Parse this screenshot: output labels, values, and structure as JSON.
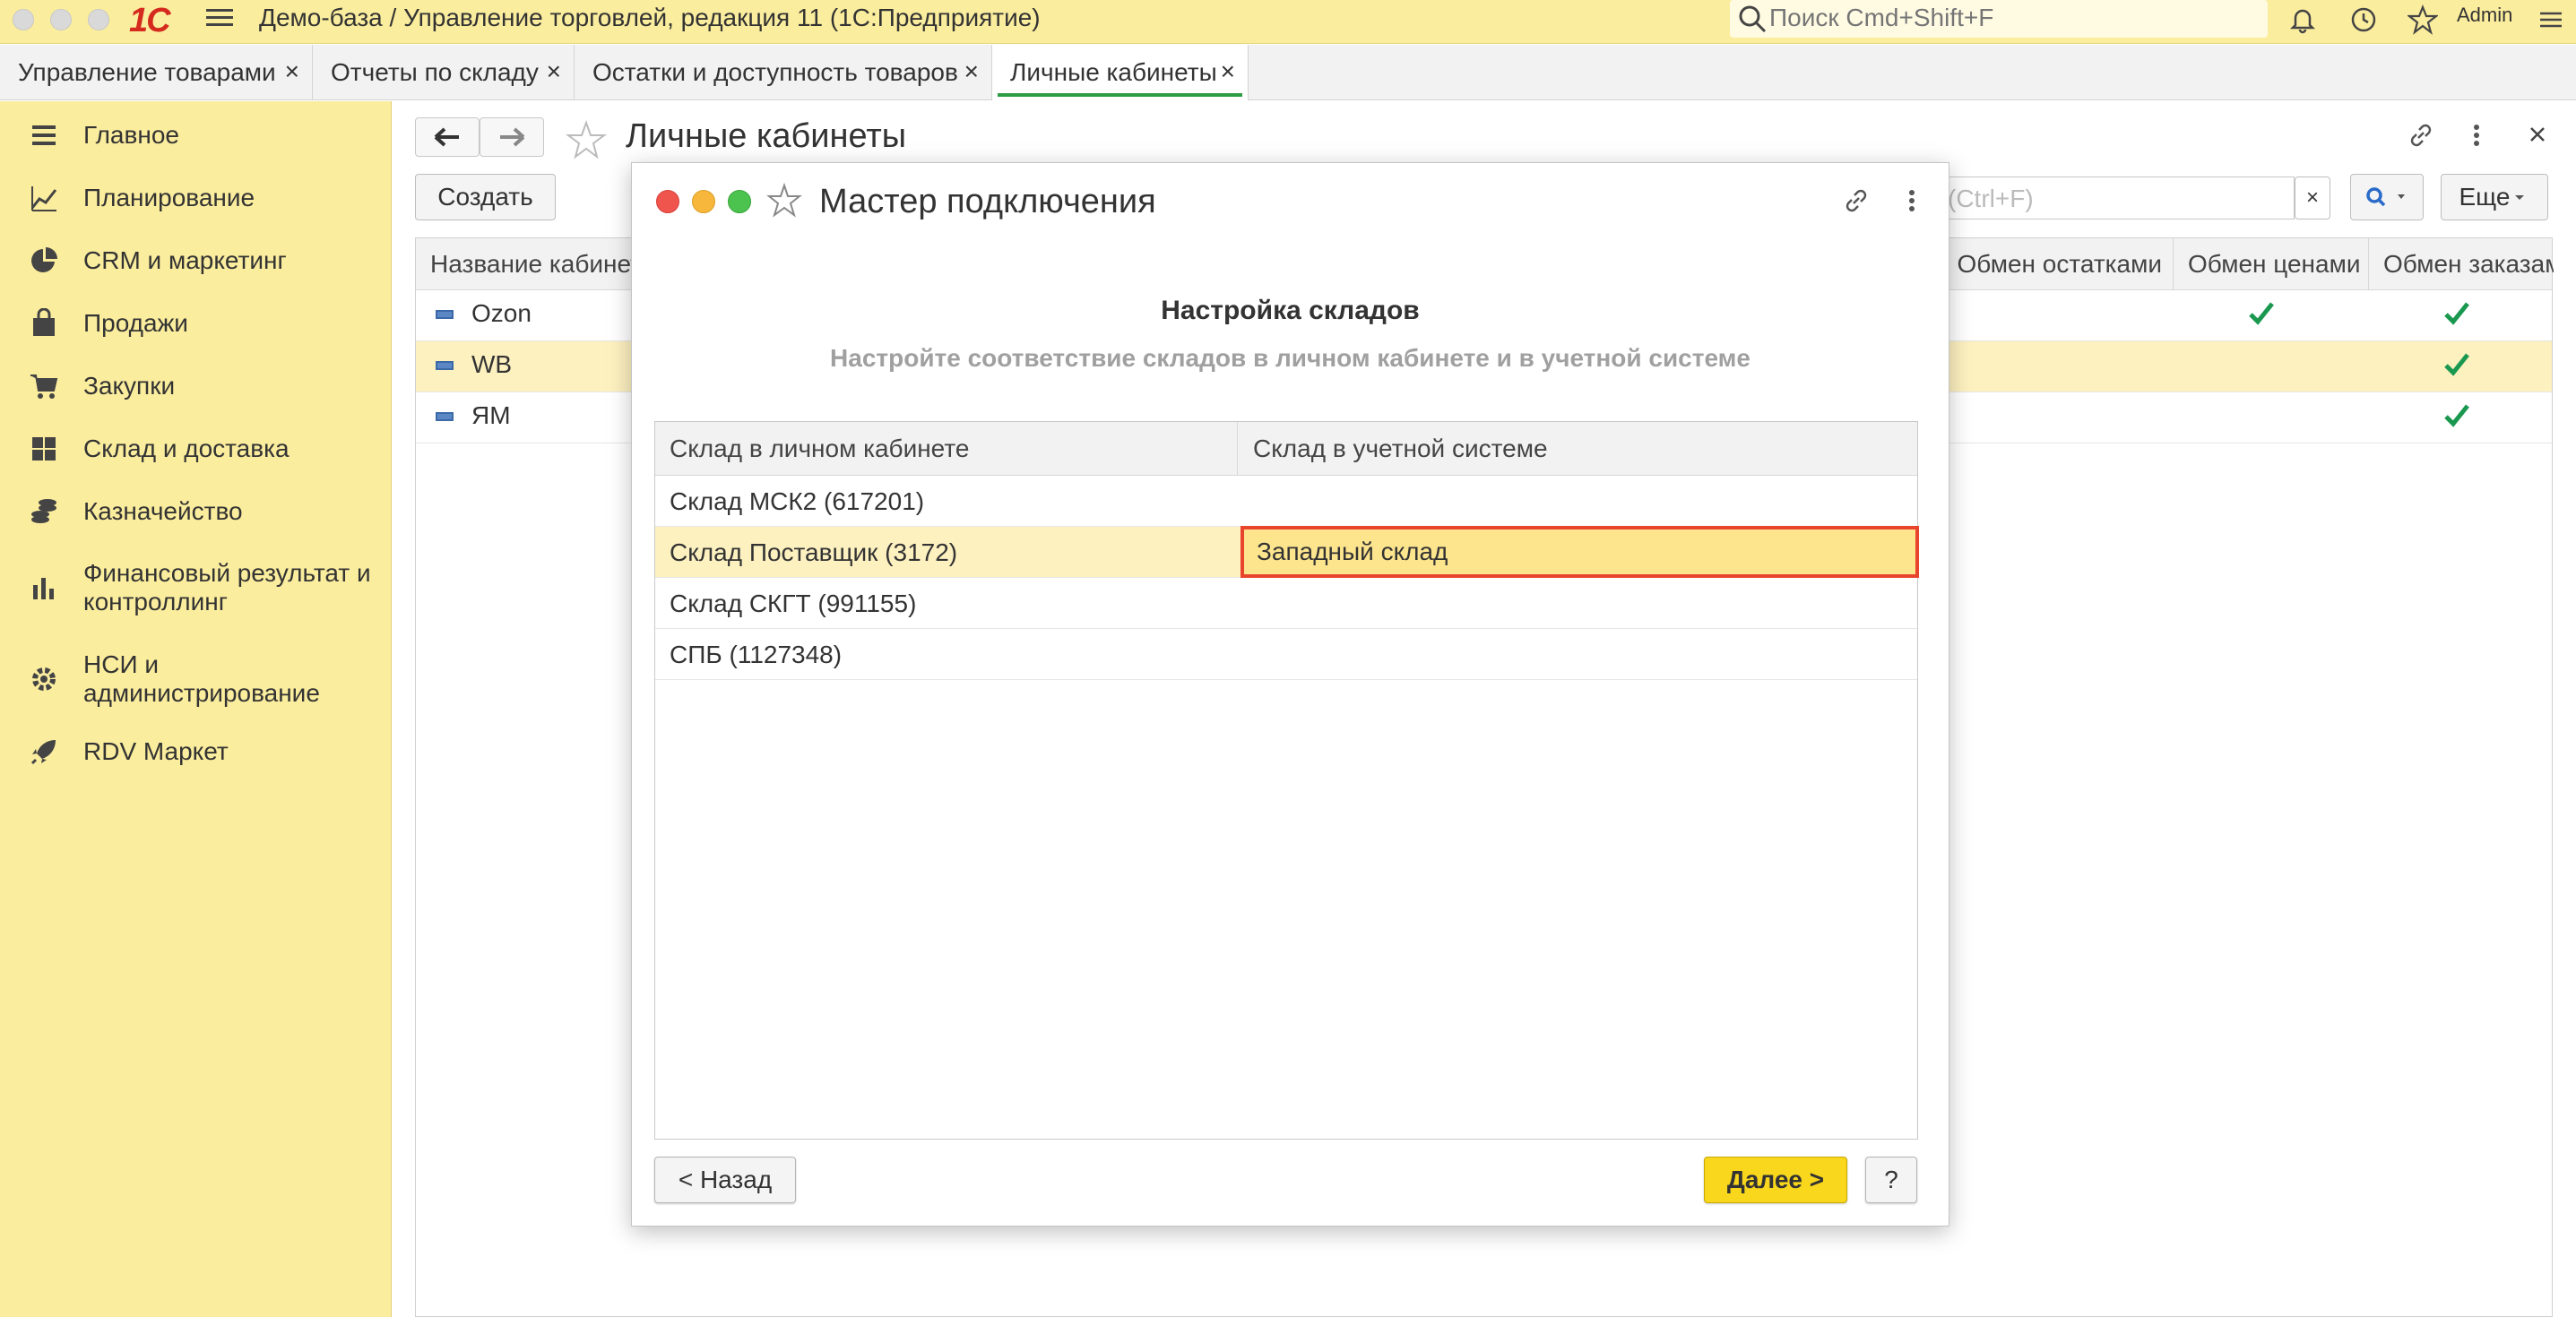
{
  "app": {
    "logo": "1С",
    "title": "Демо-база / Управление торговлей, редакция 11  (1С:Предприятие)",
    "search_placeholder": "Поиск Cmd+Shift+F",
    "user": "Admin"
  },
  "tabs": [
    {
      "label": "Управление товарами",
      "close": "×"
    },
    {
      "label": "Отчеты по складу",
      "close": "×"
    },
    {
      "label": "Остатки и доступность товаров",
      "close": "×"
    },
    {
      "label": "Личные кабинеты",
      "close": "×",
      "active": true
    }
  ],
  "sidebar": {
    "items": [
      {
        "label": "Главное",
        "icon": "menu-lines-icon"
      },
      {
        "label": "Планирование",
        "icon": "planning-chart-icon"
      },
      {
        "label": "CRM и маркетинг",
        "icon": "pie-chart-icon"
      },
      {
        "label": "Продажи",
        "icon": "shopping-bag-icon"
      },
      {
        "label": "Закупки",
        "icon": "cart-icon"
      },
      {
        "label": "Склад и доставка",
        "icon": "warehouse-grid-icon"
      },
      {
        "label": "Казначейство",
        "icon": "coins-icon"
      },
      {
        "label": "Финансовый результат и контроллинг",
        "icon": "bar-chart-icon"
      },
      {
        "label": "НСИ и администрирование",
        "icon": "gear-icon"
      },
      {
        "label": "RDV Маркет",
        "icon": "rocket-icon"
      }
    ]
  },
  "form": {
    "title": "Личные кабинеты",
    "create_button": "Создать",
    "search_hint": "(Ctrl+F)",
    "clear": "×",
    "more_button": "Еще",
    "columns": [
      "Название кабинета",
      "Обмен остатками",
      "Обмен ценами",
      "Обмен заказами"
    ],
    "rows": [
      {
        "name": "Ozon",
        "prices": true,
        "orders": true
      },
      {
        "name": "WB",
        "prices": false,
        "orders": true,
        "selected": true
      },
      {
        "name": "ЯМ",
        "prices": false,
        "orders": true
      }
    ]
  },
  "dialog": {
    "title": "Мастер подключения",
    "heading": "Настройка складов",
    "subheading": "Настройте соответствие складов в личном кабинете и в учетной системе",
    "columns": [
      "Склад в личном кабинете",
      "Склад в учетной системе"
    ],
    "rows": [
      {
        "cabinet": "Склад МСК2 (617201)",
        "system": ""
      },
      {
        "cabinet": "Склад Поставщик (3172)",
        "system": "Западный склад",
        "selected": true
      },
      {
        "cabinet": "Склад СКГТ (991155)",
        "system": ""
      },
      {
        "cabinet": "СПБ (1127348)",
        "system": ""
      }
    ],
    "back_button": "< Назад",
    "next_button": "Далее >",
    "help_button": "?"
  },
  "colors": {
    "titlebar": "#fbed9e",
    "sidebar": "#fbed9e",
    "primary_button": "#f9d71c",
    "selection": "#fdf1c0",
    "edit_border": "#e8452c",
    "check": "#1a9850"
  }
}
